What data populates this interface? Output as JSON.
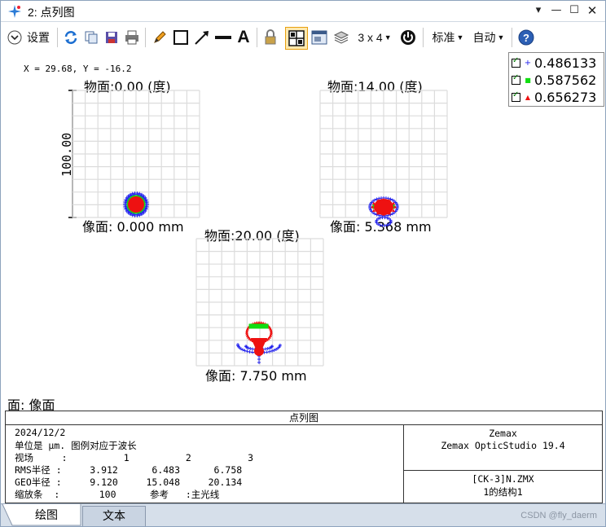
{
  "window": {
    "title": "2: 点列图"
  },
  "toolbar": {
    "settings_label": "设置",
    "layout_label": "3 x 4",
    "standard_label": "标准",
    "auto_label": "自动"
  },
  "plot": {
    "cursor_readout": "X = 29.68, Y = -16.2",
    "scale_label": "100.00",
    "fields": [
      {
        "title": "物面:0.00 (度)",
        "image": "像面: 0.000 mm"
      },
      {
        "title": "物面:14.00 (度)",
        "image": "像面: 5.368 mm"
      },
      {
        "title": "物面:20.00 (度)",
        "image": "像面: 7.750 mm"
      }
    ],
    "legend": [
      {
        "value": "0.486133",
        "color": "#2222ee",
        "marker": "+"
      },
      {
        "value": "0.587562",
        "color": "#11dd11",
        "marker": "■"
      },
      {
        "value": "0.656273",
        "color": "#ee1111",
        "marker": "▲"
      }
    ],
    "surface_label": "面: 像面"
  },
  "info": {
    "header": "点列图",
    "date": "2024/12/2",
    "units": "单位是 μm. 图例对应于波长",
    "field_row": "视场     :          1          2          3",
    "rms_row": "RMS半径 :     3.912      6.483      6.758",
    "geo_row": "GEO半径 :     9.120     15.048     20.134",
    "scale_row": "缩放条  :       100      参考   :主光线",
    "company": "Zemax",
    "product": "Zemax OpticStudio 19.4",
    "file": "[CK-3]N.ZMX",
    "config": "1的结构1"
  },
  "tabs": {
    "plot": "绘图",
    "text": "文本"
  },
  "watermark": "CSDN @fly_daerm"
}
